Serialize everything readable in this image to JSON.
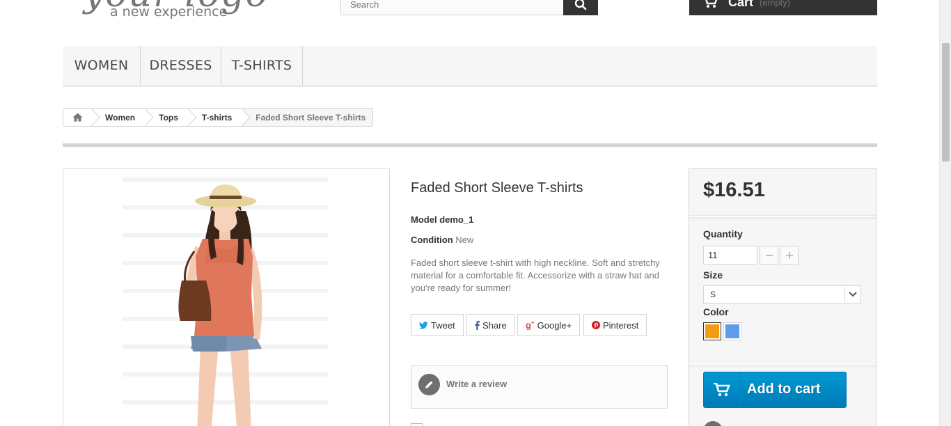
{
  "header": {
    "logo_script": "your logo",
    "logo_tagline": "a new experience",
    "search_placeholder": "Search",
    "cart_label": "Cart",
    "cart_status": "(empty)"
  },
  "menu": {
    "items": [
      {
        "label": "Women"
      },
      {
        "label": "Dresses"
      },
      {
        "label": "T-shirts"
      }
    ]
  },
  "breadcrumb": {
    "items": [
      "Women",
      "Tops",
      "T-shirts"
    ],
    "current": "Faded Short Sleeve T-shirts"
  },
  "product": {
    "title": "Faded Short Sleeve T-shirts",
    "model_label": "Model",
    "model_value": "demo_1",
    "condition_label": "Condition",
    "condition_value": "New",
    "description": "Faded short sleeve t-shirt with high neckline. Soft and stretchy material for a comfortable fit. Accessorize with a straw hat and you're ready for summer!"
  },
  "social": {
    "tweet": "Tweet",
    "share": "Share",
    "google": "Google+",
    "pinterest": "Pinterest"
  },
  "review": {
    "label": "Write a review"
  },
  "buy_box": {
    "price": "$16.51",
    "quantity_label": "Quantity",
    "quantity_value": "11",
    "size_label": "Size",
    "size_value": "S",
    "color_label": "Color",
    "colors": [
      "#f39c11",
      "#5d9cec"
    ],
    "add_to_cart": "Add to cart"
  },
  "colors": {
    "accent_blue": "#0079b6",
    "dark": "#333333"
  }
}
